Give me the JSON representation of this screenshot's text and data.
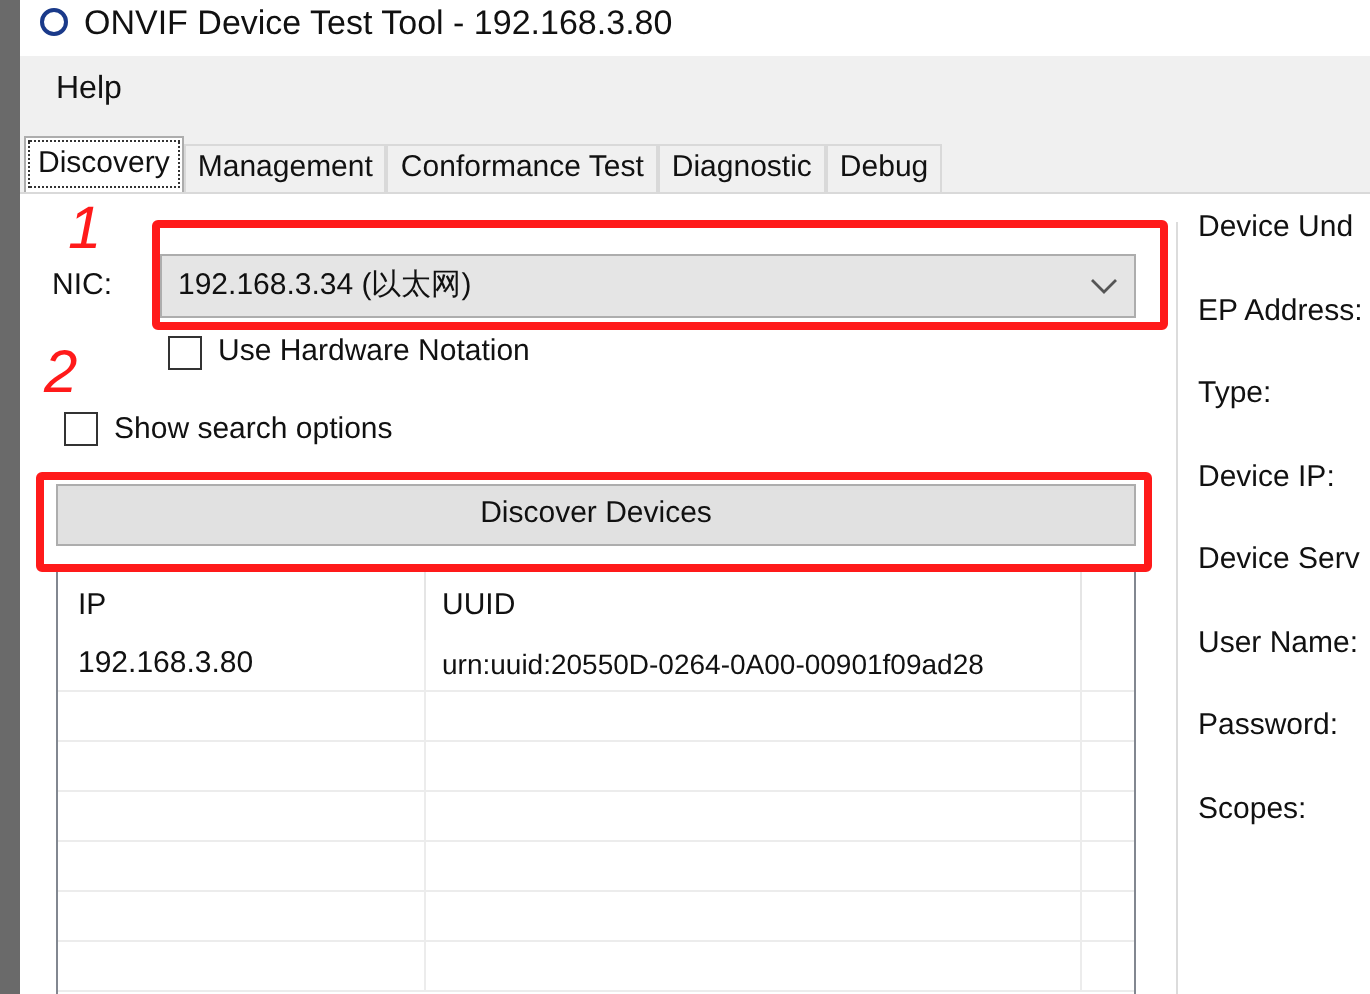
{
  "window": {
    "title": "ONVIF Device Test Tool - 192.168.3.80"
  },
  "menu": [
    {
      "label": "Help"
    }
  ],
  "tabs": [
    {
      "label": "Discovery",
      "selected": true
    },
    {
      "label": "Management",
      "selected": false
    },
    {
      "label": "Conformance Test",
      "selected": false
    },
    {
      "label": "Diagnostic",
      "selected": false
    },
    {
      "label": "Debug",
      "selected": false
    }
  ],
  "nic": {
    "label": "NIC:",
    "value": "192.168.3.34 (以太网)"
  },
  "options": [
    {
      "label": "Use Hardware Notation",
      "checked": false
    },
    {
      "label": "Show search options",
      "checked": false
    }
  ],
  "discover_button": "Discover Devices",
  "table": {
    "columns": [
      "IP",
      "UUID"
    ],
    "rows": [
      [
        "192.168.3.80",
        "urn:uuid:20550D-0264-0A00-00901f09ad28"
      ]
    ]
  },
  "device_panel": {
    "title": "Device Und",
    "fields": [
      "EP Address:",
      "Type:",
      "Device IP:",
      "Device Serv",
      "User Name:",
      "Password:",
      "Scopes:"
    ]
  },
  "annotations": [
    "1",
    "2"
  ]
}
